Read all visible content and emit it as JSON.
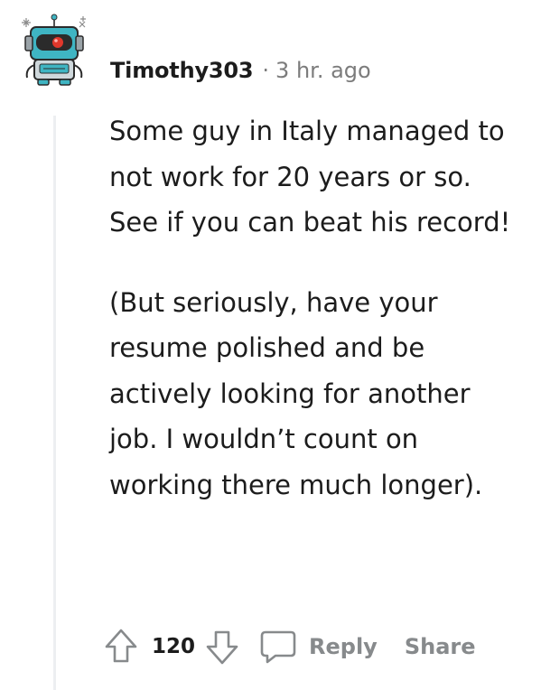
{
  "comment": {
    "author": "Timothy303",
    "separator": "·",
    "time": "3 hr. ago",
    "paragraphs": [
      "Some guy in Italy managed to not work for 20 years or so. See if you can beat his record!",
      "(But seriously, have your resume polished and be actively looking for another job. I wouldn’t count on working there much longer)."
    ],
    "votes": "120",
    "actions": {
      "reply": "Reply",
      "share": "Share"
    }
  },
  "colors": {
    "text": "#1c1c1c",
    "meta": "#7c7c7c",
    "action": "#878a8c",
    "thread_line": "#edeff1",
    "avatar_teal": "#3fb5c3",
    "avatar_red": "#e0382c"
  },
  "icons": {
    "upvote": "arrow-up-icon",
    "downvote": "arrow-down-icon",
    "reply": "speech-bubble-icon",
    "avatar": "robot-snoo-avatar"
  }
}
